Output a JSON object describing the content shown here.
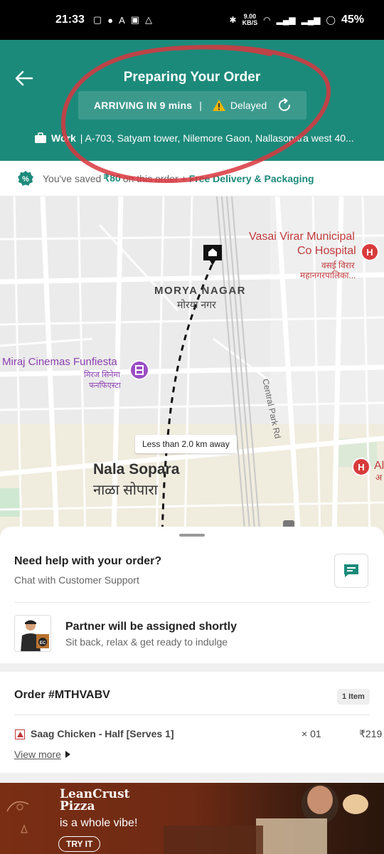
{
  "status_bar": {
    "time": "21:33",
    "speed_value": "9.00",
    "speed_unit": "KB/S",
    "battery": "45%"
  },
  "header": {
    "title": "Preparing Your Order",
    "eta": "ARRIVING IN 9 mins",
    "separator": "|",
    "status": "Delayed",
    "address_label": "Work",
    "address": "| A-703, Satyam tower, Nilemore Gaon, Nallasopara west 40..."
  },
  "savings": {
    "prefix": "You've saved",
    "amount": "₹80",
    "middle": "on this order +",
    "free_text": "Free Delivery & Packaging"
  },
  "map": {
    "poi_hospital": "Vasai Virar Municipal",
    "poi_hospital_line2": "Co Hospital",
    "poi_hospital_sub": "वसई विरार",
    "poi_hospital_sub2": "महानगरपालिका...",
    "area": "MORYA NAGAR",
    "area_sub": "मोरया नगर",
    "poi_cinema": "Miraj Cinemas Funfiesta",
    "poi_cinema_sub": "मिरज सिनेमा",
    "poi_cinema_sub2": "फनफिएस्टा",
    "road": "Central Park Rd",
    "distance": "Less than 2.0 km away",
    "city": "Nala Sopara",
    "city_sub": "नाळा सोपारा",
    "poi_right": "Al",
    "poi_right_sub": "अ"
  },
  "help": {
    "title": "Need help with your order?",
    "subtitle": "Chat with Customer Support"
  },
  "partner": {
    "title": "Partner will be assigned shortly",
    "subtitle": "Sit back, relax & get ready to indulge",
    "badge": "EC"
  },
  "order": {
    "id": "Order #MTHVABV",
    "count": "1 Item",
    "items": [
      {
        "name": "Saag Chicken - Half [Serves 1]",
        "qty": "01",
        "price": "₹219"
      }
    ],
    "view_more": "View more"
  },
  "promo": {
    "brand_line1": "LeanCrust",
    "brand_line2": "Pizza",
    "tagline": "is a whole vibe!",
    "cta": "TRY IT"
  },
  "colors": {
    "brand": "#1c8a7b",
    "warning": "#f0b400",
    "poi_red": "#c0393b",
    "poi_purple": "#8c3fb0"
  }
}
